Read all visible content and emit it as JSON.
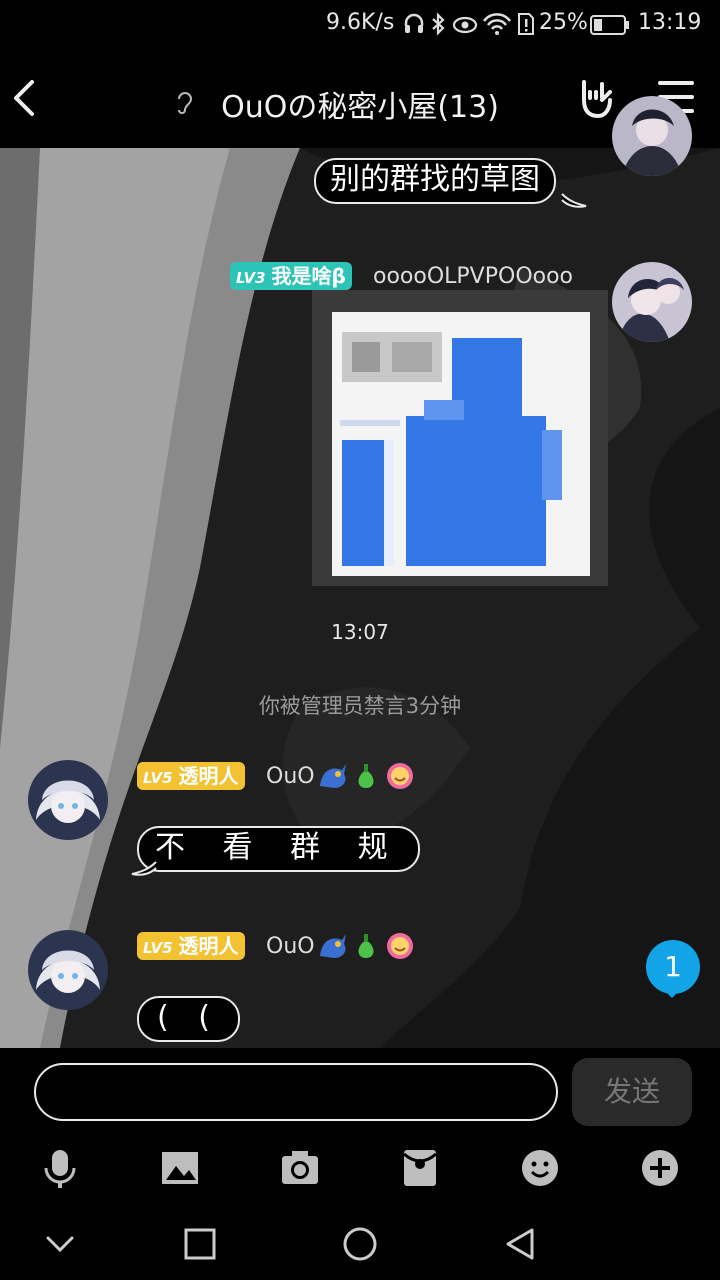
{
  "status_bar": {
    "speed": "9.6K/s",
    "battery": "25%",
    "time": "13:19"
  },
  "header": {
    "title": "OuOの秘密小屋(13)"
  },
  "messages": [
    {
      "type": "text",
      "side": "right",
      "text": "别的群找的草图"
    },
    {
      "type": "image",
      "side": "right",
      "level": "LV3",
      "title_badge": "我是啥β",
      "nickname": "ooooOLPVPOOooo"
    },
    {
      "type": "time",
      "text": "13:07"
    },
    {
      "type": "system",
      "text": "你被管理员禁言3分钟"
    },
    {
      "type": "text",
      "side": "left",
      "level": "LV5",
      "title_badge": "透明人",
      "nickname": "OuO",
      "text": "不 看 群 规"
    },
    {
      "type": "text",
      "side": "left",
      "level": "LV5",
      "title_badge": "透明人",
      "nickname": "OuO",
      "text": "( ("
    }
  ],
  "unread_count": "1",
  "input": {
    "placeholder": "",
    "send_label": "发送"
  },
  "toolbar": {
    "icons": [
      "microphone-icon",
      "image-icon",
      "camera-icon",
      "red-packet-icon",
      "emoji-icon",
      "plus-icon"
    ]
  },
  "nav_bar": {
    "icons": [
      "chevron-down-icon",
      "recents-icon",
      "home-icon",
      "back-icon"
    ]
  },
  "colors": {
    "lv3_badge": "#2ec3b7",
    "lv5_badge": "#f2c233",
    "unread_badge": "#12a4e6",
    "image_blue": "#3478e8"
  }
}
